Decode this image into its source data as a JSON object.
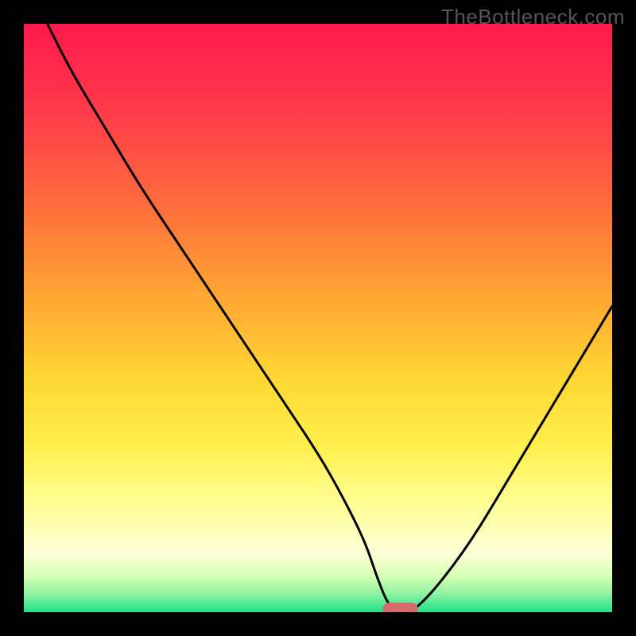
{
  "watermark": "TheBottleneck.com",
  "chart_data": {
    "type": "line",
    "title": "",
    "xlabel": "",
    "ylabel": "",
    "xlim": [
      0,
      100
    ],
    "ylim": [
      0,
      100
    ],
    "grid": false,
    "legend": false,
    "background_gradient": {
      "stops": [
        {
          "offset": 0.0,
          "color": "#ff1a4d"
        },
        {
          "offset": 0.15,
          "color": "#ff3b4a"
        },
        {
          "offset": 0.3,
          "color": "#ff6a3d"
        },
        {
          "offset": 0.45,
          "color": "#ffa233"
        },
        {
          "offset": 0.6,
          "color": "#ffd633"
        },
        {
          "offset": 0.72,
          "color": "#fff04d"
        },
        {
          "offset": 0.83,
          "color": "#ffffa0"
        },
        {
          "offset": 0.9,
          "color": "#ffffd8"
        },
        {
          "offset": 0.94,
          "color": "#d4ffb3"
        },
        {
          "offset": 0.97,
          "color": "#8cf2a0"
        },
        {
          "offset": 1.0,
          "color": "#1fe08a"
        }
      ]
    },
    "series": [
      {
        "name": "bottleneck-curve",
        "x": [
          4,
          8,
          14,
          20,
          26,
          32,
          38,
          44,
          50,
          54,
          58,
          60,
          62,
          64,
          66,
          70,
          76,
          82,
          88,
          94,
          100
        ],
        "y": [
          100,
          92,
          82,
          72,
          63,
          54,
          45,
          36,
          27,
          20,
          12,
          6,
          1,
          0,
          0,
          4,
          12,
          22,
          32,
          42,
          52
        ]
      }
    ],
    "marker": {
      "name": "optimal-point",
      "x": 64,
      "y": 0.5,
      "color": "#d46a6a",
      "width": 6,
      "height": 2.2,
      "rx": 1.1
    }
  }
}
